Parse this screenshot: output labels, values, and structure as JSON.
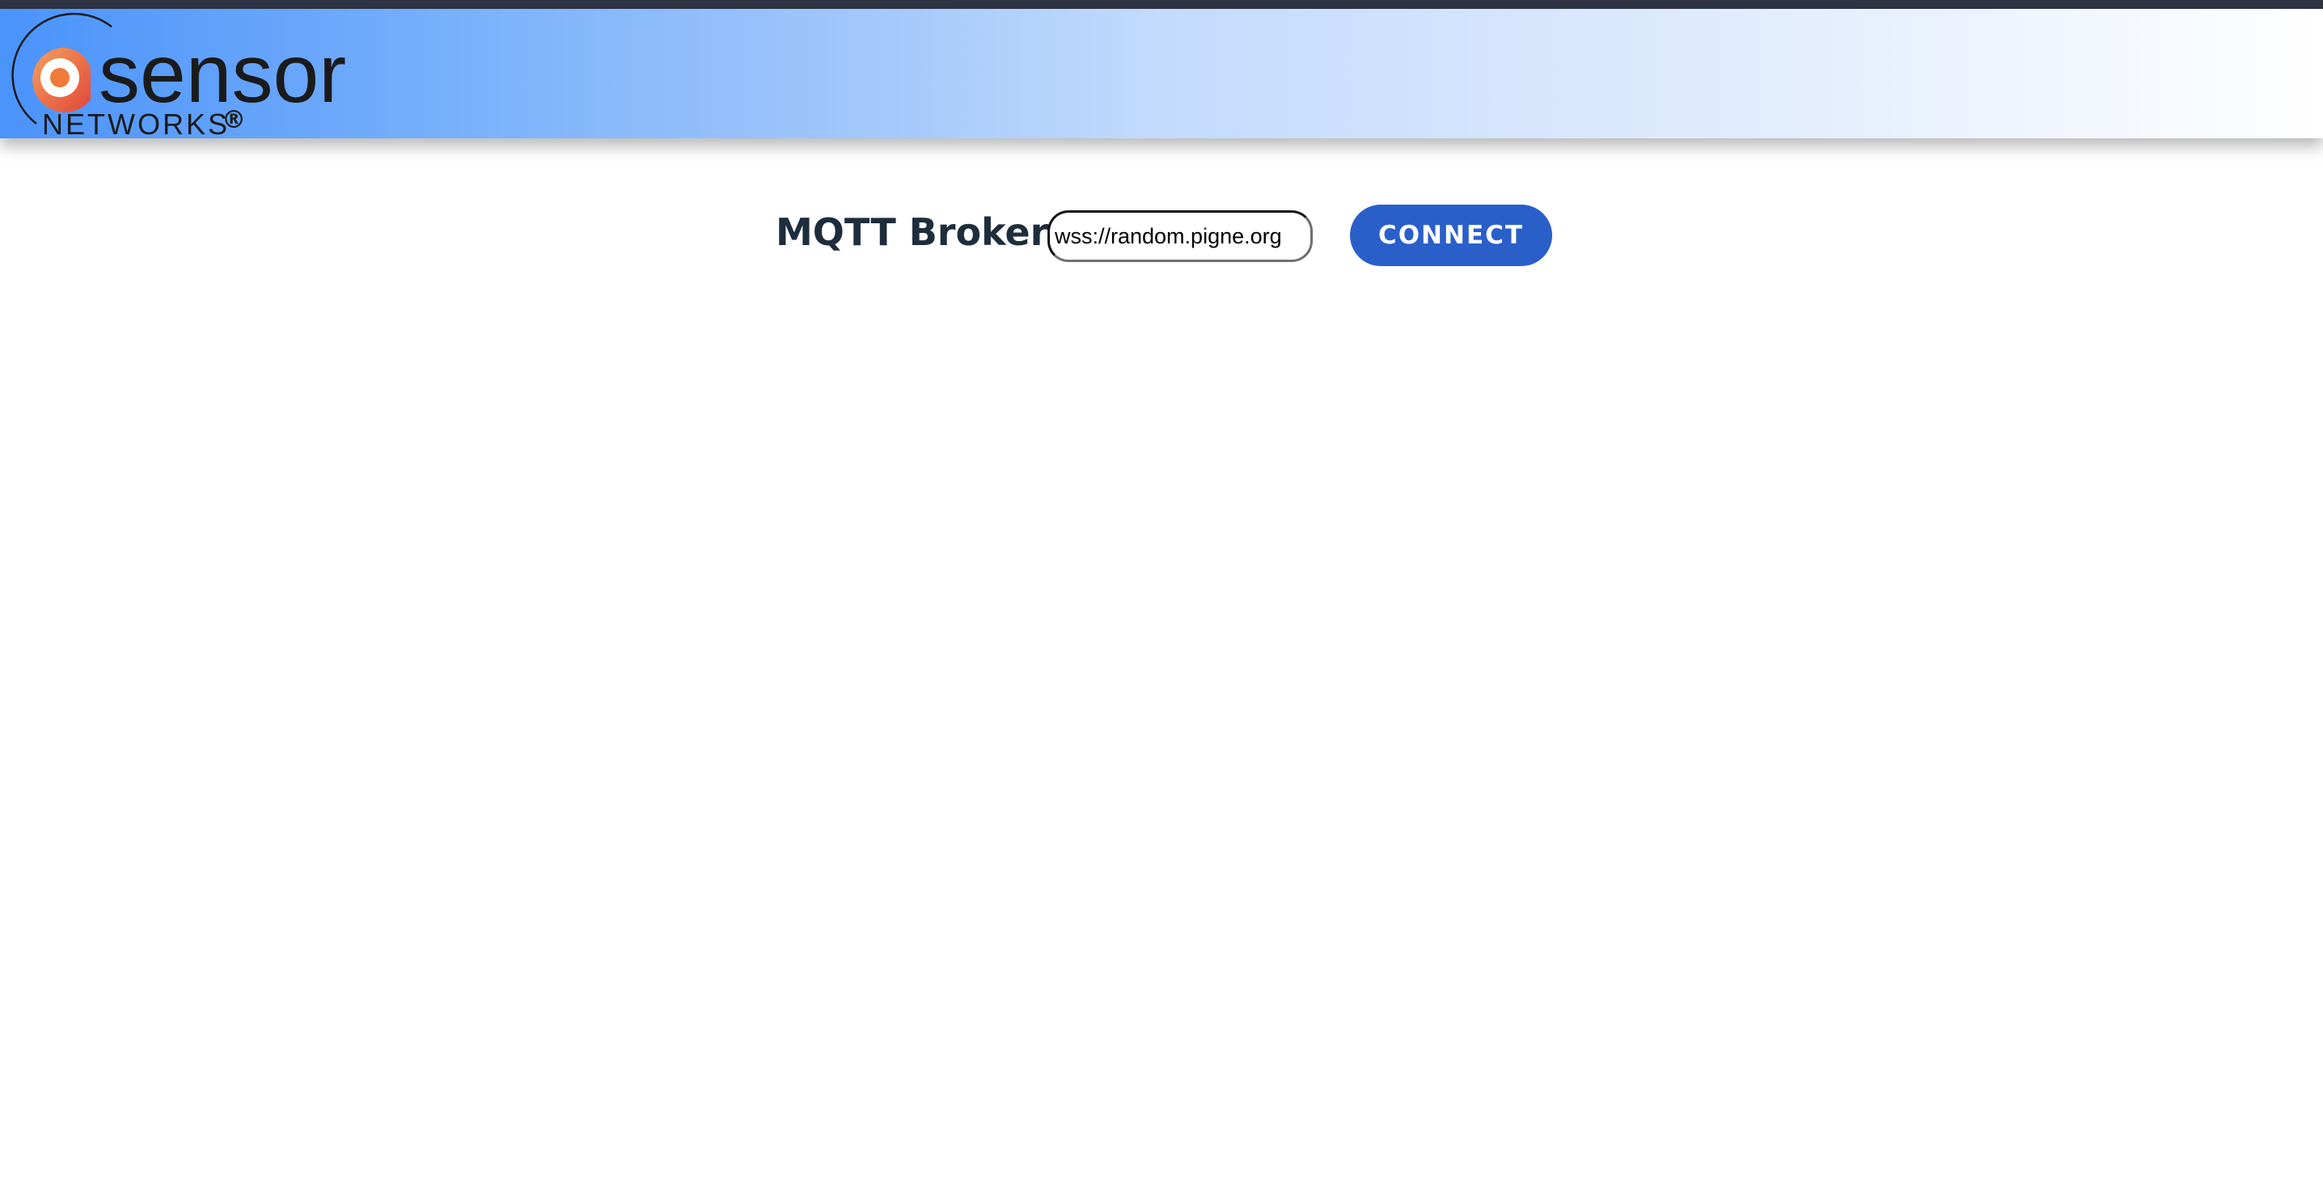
{
  "header": {
    "logo": {
      "wordmark": "sensor",
      "subtitle": "NETWORKS",
      "registered": "®"
    }
  },
  "broker": {
    "label": "MQTT Broker:",
    "input_value": "wss://random.pigne.org",
    "connect_label": "CONNECT"
  },
  "colors": {
    "accent": "#2a5fca",
    "header_gradient_start": "#4a93fb",
    "header_gradient_end": "#ffffff",
    "logo_orange": "#f07a3a",
    "label_text": "#1e2d3c"
  }
}
